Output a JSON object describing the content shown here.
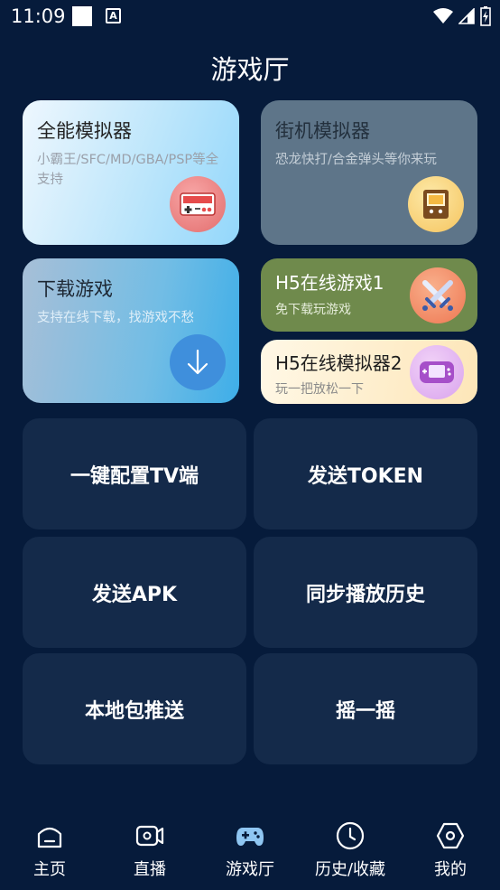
{
  "status_bar": {
    "time": "11:09",
    "notification_icon": "a-box-icon"
  },
  "page": {
    "title": "游戏厅"
  },
  "cards": {
    "all_in_one": {
      "title": "全能模拟器",
      "subtitle": "小霸王/SFC/MD/GBA/PSP等全支持",
      "icon": "gamepad-icon",
      "colors": [
        "#eef7fe",
        "#93d7fb"
      ]
    },
    "arcade": {
      "title": "街机模拟器",
      "subtitle": "恐龙快打/合金弹头等你来玩",
      "icon": "arcade-cabinet-icon",
      "color": "#5e7589"
    },
    "download": {
      "title": "下载游戏",
      "subtitle": "支持在线下载，找游戏不愁",
      "icon": "download-arrow-icon",
      "colors": [
        "#a7bfd7",
        "#3eaee8"
      ]
    },
    "h5_game": {
      "title": "H5在线游戏1",
      "subtitle": "免下载玩游戏",
      "icon": "crossed-swords-icon",
      "color": "#6f8a4c"
    },
    "h5_emulator": {
      "title": "H5在线模拟器2",
      "subtitle": "玩一把放松一下",
      "icon": "handheld-console-icon",
      "colors": [
        "#fff8e6",
        "#fde6b8"
      ]
    }
  },
  "actions": {
    "tv_config": "一键配置TV端",
    "send_token": "发送TOKEN",
    "send_apk": "发送APK",
    "sync_history": "同步播放历史",
    "local_push": "本地包推送",
    "shake": "摇一摇"
  },
  "bottom_nav": {
    "items": [
      {
        "label": "主页",
        "icon": "home-icon",
        "active": false
      },
      {
        "label": "直播",
        "icon": "live-camera-icon",
        "active": false
      },
      {
        "label": "游戏厅",
        "icon": "gamepad-icon",
        "active": true
      },
      {
        "label": "历史/收藏",
        "icon": "clock-icon",
        "active": false
      },
      {
        "label": "我的",
        "icon": "profile-hexagon-icon",
        "active": false
      }
    ],
    "active_color": "#8fc6f2"
  },
  "theme": {
    "background": "#061b3b",
    "button_bg": "#142a4a"
  }
}
